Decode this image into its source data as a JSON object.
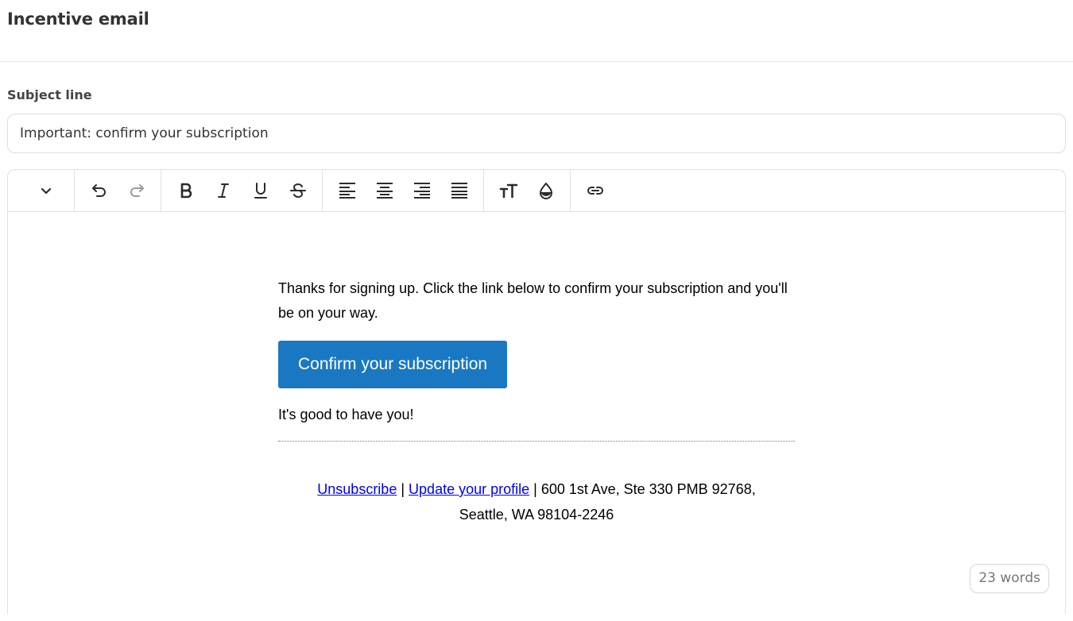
{
  "page": {
    "title": "Incentive email"
  },
  "subject": {
    "label": "Subject line",
    "value": "Important: confirm your subscription"
  },
  "toolbar": {
    "icons": [
      "chevron-down-icon",
      "undo-icon",
      "redo-icon",
      "bold-icon",
      "italic-icon",
      "underline-icon",
      "strikethrough-icon",
      "align-left-icon",
      "align-center-icon",
      "align-right-icon",
      "align-justify-icon",
      "font-size-icon",
      "color-drop-icon",
      "link-icon"
    ]
  },
  "email": {
    "intro": "Thanks for signing up. Click the link below to confirm your subscription and you'll be on your way.",
    "cta_label": "Confirm your subscription",
    "closing": "It's good to have you!",
    "footer": {
      "unsubscribe": "Unsubscribe",
      "separator": "|",
      "update_profile": "Update your profile",
      "address_line1": "600 1st Ave, Ste 330 PMB 92768,",
      "address_line2": "Seattle, WA 98104-2246"
    }
  },
  "word_count": "23 words",
  "colors": {
    "cta_background": "#1a78c2",
    "link": "#0000ee"
  }
}
